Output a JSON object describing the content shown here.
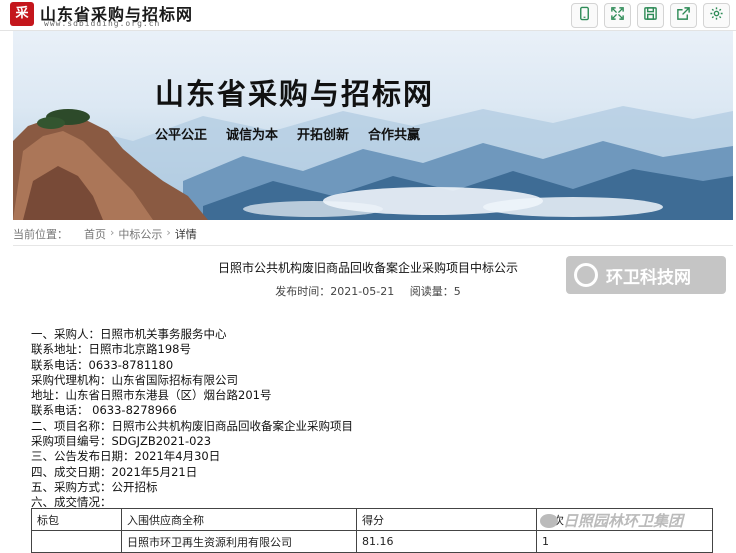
{
  "site": {
    "logo_char": "采",
    "title": "山东省采购与招标网",
    "url": "www.sdbidding.org.cn"
  },
  "toolbar": {
    "icons": [
      "phone-icon",
      "fullscreen-icon",
      "save-icon",
      "share-icon",
      "settings-icon"
    ]
  },
  "banner": {
    "title": "山东省采购与招标网",
    "slogans": [
      "公平公正",
      "诚信为本",
      "开拓创新",
      "合作共赢"
    ]
  },
  "breadcrumb": {
    "label": "当前位置：",
    "home": "首页",
    "section": "中标公示",
    "current": "详情"
  },
  "article": {
    "title": "日照市公共机构废旧商品回收备案企业采购项目中标公示",
    "publish_label": "发布时间：2021-05-21",
    "views_label": "阅读量：5",
    "lines": [
      "一、采购人：日照市机关事务服务中心",
      "联系地址：日照市北京路198号",
      "联系电话：0633-8781180",
      "采购代理机构：山东省国际招标有限公司",
      "地址：山东省日照市东港县（区）烟台路201号",
      "联系电话： 0633-8278966",
      "二、项目名称：日照市公共机构废旧商品回收备案企业采购项目",
      "采购项目编号：SDGJZB2021-023",
      "三、公告发布日期：2021年4月30日",
      "四、成交日期：2021年5月21日",
      "五、采购方式：公开招标",
      "六、成交情况："
    ]
  },
  "table": {
    "headers": [
      "标包",
      "入围供应商全称",
      "得分",
      "名次"
    ],
    "rows": [
      [
        "",
        "日照市环卫再生资源利用有限公司",
        "81.16",
        "1"
      ]
    ]
  },
  "watermarks": {
    "top": "环卫科技网",
    "bottom": "日照园林环卫集团"
  }
}
